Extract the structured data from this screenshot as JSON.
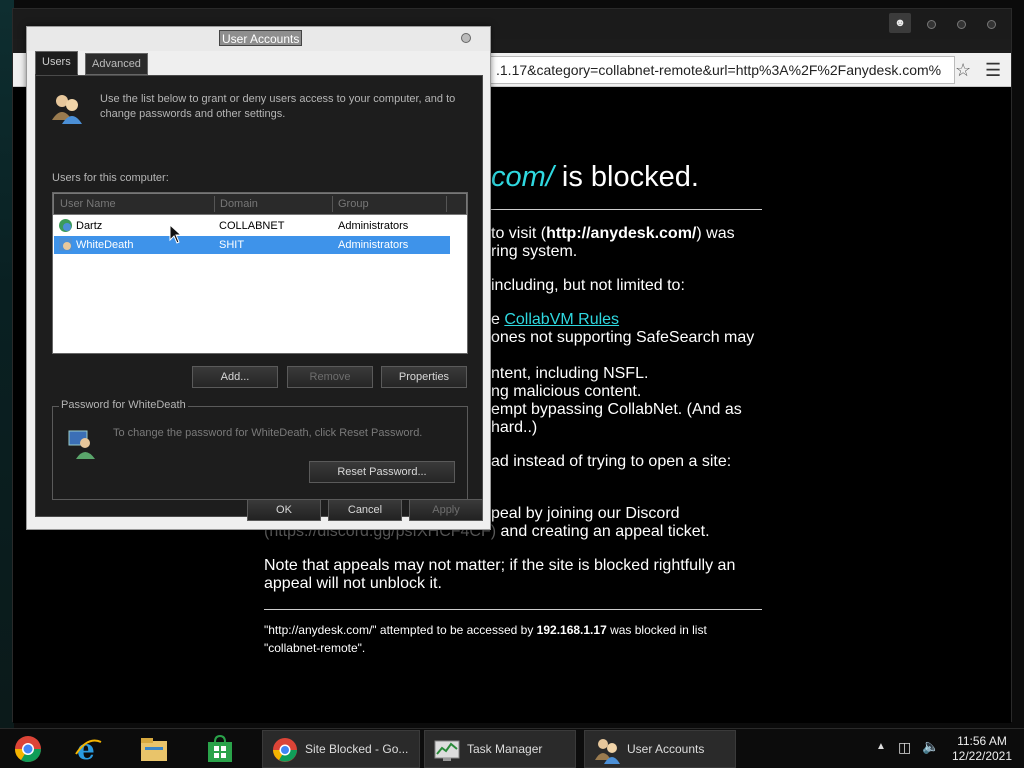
{
  "browser": {
    "url": ".1.17&category=collabnet-remote&url=http%3A%2F%2Fanydesk.com%",
    "page": {
      "title_domain": "com/",
      "title_rest": " is blocked.",
      "lines": [
        {
          "pre": " to visit (",
          "bold": "http://anydesk.com/",
          "post": ") was"
        },
        {
          "text": "ring system."
        },
        {
          "text": " including, but not limited to:"
        },
        {
          "pre": "e ",
          "link": "CollabVM Rules",
          "post": ""
        },
        {
          "text": " ones not supporting SafeSearch may"
        },
        {
          "text": "ntent, including NSFL."
        },
        {
          "text": "ng malicious content."
        },
        {
          "text": "empt bypassing CollabNet. (And as"
        },
        {
          "text": "hard..)"
        },
        {
          "text": " ad instead of trying to open a site:"
        },
        {
          "text": "peal by joining our Discord"
        },
        {
          "dim": "(https://discord.gg/psfXHCF4CF)",
          "post": " and creating an appeal ticket."
        },
        {
          "text": "Note that appeals may not matter; if the site is blocked rightfully an"
        },
        {
          "text": "appeal will not unblock it."
        }
      ],
      "footer": {
        "pre": "\"http://anydesk.com/\" attempted to be accessed by ",
        "ip": "192.168.1.17",
        "post": " was blocked in list",
        "line2": "\"collabnet-remote\"."
      }
    }
  },
  "dialog": {
    "title": "User Accounts",
    "tabs": [
      "Users",
      "Advanced"
    ],
    "intro": "Use the list below to grant or deny users access to your computer, and to change passwords and other settings.",
    "users_label": "Users for this computer:",
    "columns": [
      "User Name",
      "Domain",
      "Group"
    ],
    "rows": [
      {
        "name": "Dartz",
        "domain": "COLLABNET",
        "group": "Administrators"
      },
      {
        "name": "WhiteDeath",
        "domain": "SHIT",
        "group": "Administrators"
      }
    ],
    "buttons": {
      "add": "Add...",
      "remove": "Remove",
      "properties": "Properties"
    },
    "password_group": "Password for WhiteDeath",
    "password_text": "To change the password for WhiteDeath, click Reset Password.",
    "reset_password": "Reset Password...",
    "ok": "OK",
    "cancel": "Cancel",
    "apply": "Apply"
  },
  "taskbar": {
    "pinned": [
      "chrome-icon",
      "ie-icon",
      "explorer-icon",
      "store-icon"
    ],
    "tasks": [
      {
        "label": "Site Blocked - Go...",
        "icon": "chrome-icon"
      },
      {
        "label": "Task Manager",
        "icon": "task-manager-icon"
      },
      {
        "label": "User Accounts",
        "icon": "users-icon"
      }
    ],
    "time": "11:56 AM",
    "date": "12/22/2021"
  }
}
